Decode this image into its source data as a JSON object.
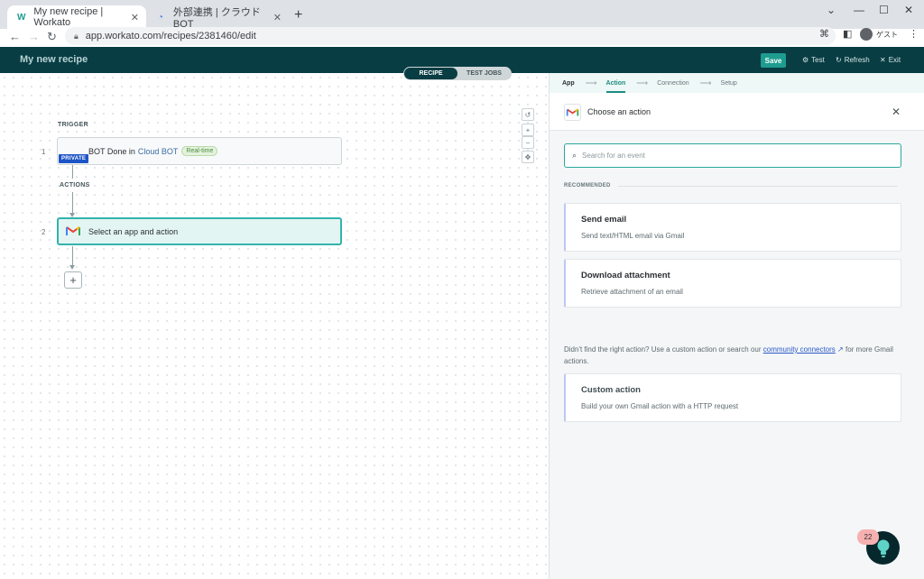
{
  "browser": {
    "tabs": [
      {
        "title": "My new recipe | Workato"
      },
      {
        "title": "外部連携 | クラウドBOT"
      }
    ],
    "address": "app.workato.com/recipes/2381460/edit",
    "profile_label": "ゲスト"
  },
  "header": {
    "recipe_title": "My new recipe",
    "save_label": "Save",
    "test_label": "Test",
    "refresh_label": "Refresh",
    "exit_label": "Exit",
    "toggle": [
      "RECIPE",
      "TEST JOBS"
    ]
  },
  "canvas": {
    "trigger_label": "TRIGGER",
    "actions_label": "ACTIONS",
    "steps": [
      {
        "number": "1",
        "text": "BOT Done in",
        "app": "Cloud BOT",
        "badge": "Real-time",
        "tag": "PRIVATE"
      },
      {
        "number": "2",
        "text": "Select an app and action"
      }
    ],
    "add_symbol": "+"
  },
  "panel": {
    "wizard": [
      "App",
      "Action",
      "Connection",
      "Setup"
    ],
    "header": "Choose an action",
    "search_placeholder": "Search for an event",
    "recommended_label": "RECOMMENDED",
    "recommended": [
      {
        "title": "Send email",
        "desc": "Send text/HTML email via Gmail"
      },
      {
        "title": "Download attachment",
        "desc": "Retrieve attachment of an email"
      }
    ],
    "help_prefix": "Didn't find the right action? Use a custom action or search our",
    "help_link": "community connectors",
    "help_suffix": "for more Gmail actions.",
    "custom": {
      "title": "Custom action",
      "desc": "Build your own Gmail action with a HTTP request"
    }
  },
  "assistant": {
    "count": "22"
  },
  "colors": {
    "header_bg": "#083d43",
    "accent": "#1e9c8f",
    "selected_step": "#e3f5f3"
  }
}
